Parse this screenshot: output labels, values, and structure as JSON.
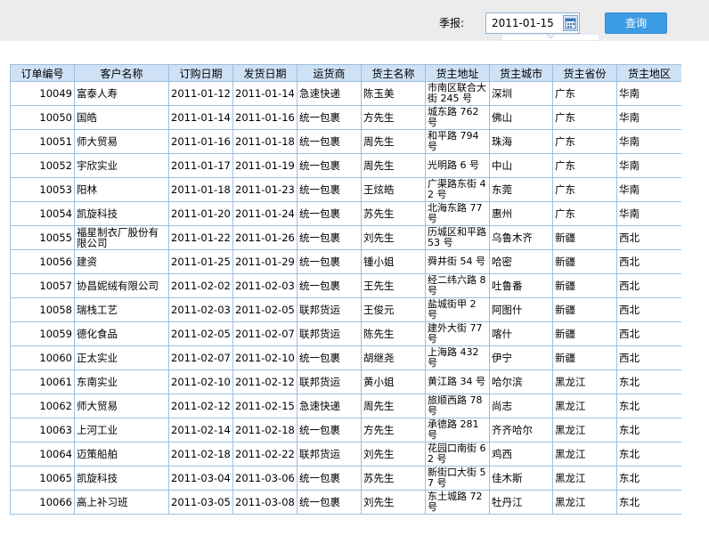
{
  "filter": {
    "label": "季报:",
    "date_value": "2011-01-15",
    "query_label": "查询"
  },
  "table": {
    "columns": [
      "订单编号",
      "客户名称",
      "订购日期",
      "发货日期",
      "运货商",
      "货主名称",
      "货主地址",
      "货主城市",
      "货主省份",
      "货主地区"
    ],
    "rows": [
      [
        "10049",
        "富泰人寿",
        "2011-01-12",
        "2011-01-14",
        "急速快递",
        "陈玉美",
        "市南区联合大街 245 号",
        "深圳",
        "广东",
        "华南"
      ],
      [
        "10050",
        "国皓",
        "2011-01-14",
        "2011-01-16",
        "统一包裹",
        "方先生",
        "城东路 762 号",
        "佛山",
        "广东",
        "华南"
      ],
      [
        "10051",
        "师大贸易",
        "2011-01-16",
        "2011-01-18",
        "统一包裹",
        "周先生",
        "和平路 794 号",
        "珠海",
        "广东",
        "华南"
      ],
      [
        "10052",
        "宇欣实业",
        "2011-01-17",
        "2011-01-19",
        "统一包裹",
        "周先生",
        "光明路 6 号",
        "中山",
        "广东",
        "华南"
      ],
      [
        "10053",
        "阳林",
        "2011-01-18",
        "2011-01-23",
        "统一包裹",
        "王炫皓",
        "广渠路东街 42 号",
        "东莞",
        "广东",
        "华南"
      ],
      [
        "10054",
        "凯旋科技",
        "2011-01-20",
        "2011-01-24",
        "统一包裹",
        "苏先生",
        "北海东路 77 号",
        "惠州",
        "广东",
        "华南"
      ],
      [
        "10055",
        "福星制衣厂股份有限公司",
        "2011-01-22",
        "2011-01-26",
        "统一包裹",
        "刘先生",
        "历城区和平路 53 号",
        "乌鲁木齐",
        "新疆",
        "西北"
      ],
      [
        "10056",
        "建资",
        "2011-01-25",
        "2011-01-29",
        "统一包裹",
        "锺小姐",
        "舜井街 54 号",
        "哈密",
        "新疆",
        "西北"
      ],
      [
        "10057",
        "协昌妮绒有限公司",
        "2011-02-02",
        "2011-02-03",
        "统一包裹",
        "王先生",
        "经二纬六路 8 号",
        "吐鲁番",
        "新疆",
        "西北"
      ],
      [
        "10058",
        "瑞栈工艺",
        "2011-02-03",
        "2011-02-05",
        "联邦货运",
        "王俊元",
        "盐城街甲 2 号",
        "阿图什",
        "新疆",
        "西北"
      ],
      [
        "10059",
        "德化食品",
        "2011-02-05",
        "2011-02-07",
        "联邦货运",
        "陈先生",
        "建外大街 77 号",
        "喀什",
        "新疆",
        "西北"
      ],
      [
        "10060",
        "正太实业",
        "2011-02-07",
        "2011-02-10",
        "统一包裹",
        "胡继尧",
        "上海路 432 号",
        "伊宁",
        "新疆",
        "西北"
      ],
      [
        "10061",
        "东南实业",
        "2011-02-10",
        "2011-02-12",
        "联邦货运",
        "黄小姐",
        "黄江路 34 号",
        "哈尔滨",
        "黑龙江",
        "东北"
      ],
      [
        "10062",
        "师大贸易",
        "2011-02-12",
        "2011-02-15",
        "急速快递",
        "周先生",
        "旅顺西路 78 号",
        "尚志",
        "黑龙江",
        "东北"
      ],
      [
        "10063",
        "上河工业",
        "2011-02-14",
        "2011-02-18",
        "统一包裹",
        "方先生",
        "承德路 281 号",
        "齐齐哈尔",
        "黑龙江",
        "东北"
      ],
      [
        "10064",
        "迈策船舶",
        "2011-02-18",
        "2011-02-22",
        "联邦货运",
        "刘先生",
        "花园口南街 62 号",
        "鸡西",
        "黑龙江",
        "东北"
      ],
      [
        "10065",
        "凯旋科技",
        "2011-03-04",
        "2011-03-06",
        "统一包裹",
        "苏先生",
        "新街口大街 57 号",
        "佳木斯",
        "黑龙江",
        "东北"
      ],
      [
        "10066",
        "高上补习班",
        "2011-03-05",
        "2011-03-08",
        "统一包裹",
        "刘先生",
        "东土城路 72 号",
        "牡丹江",
        "黑龙江",
        "东北"
      ]
    ]
  }
}
